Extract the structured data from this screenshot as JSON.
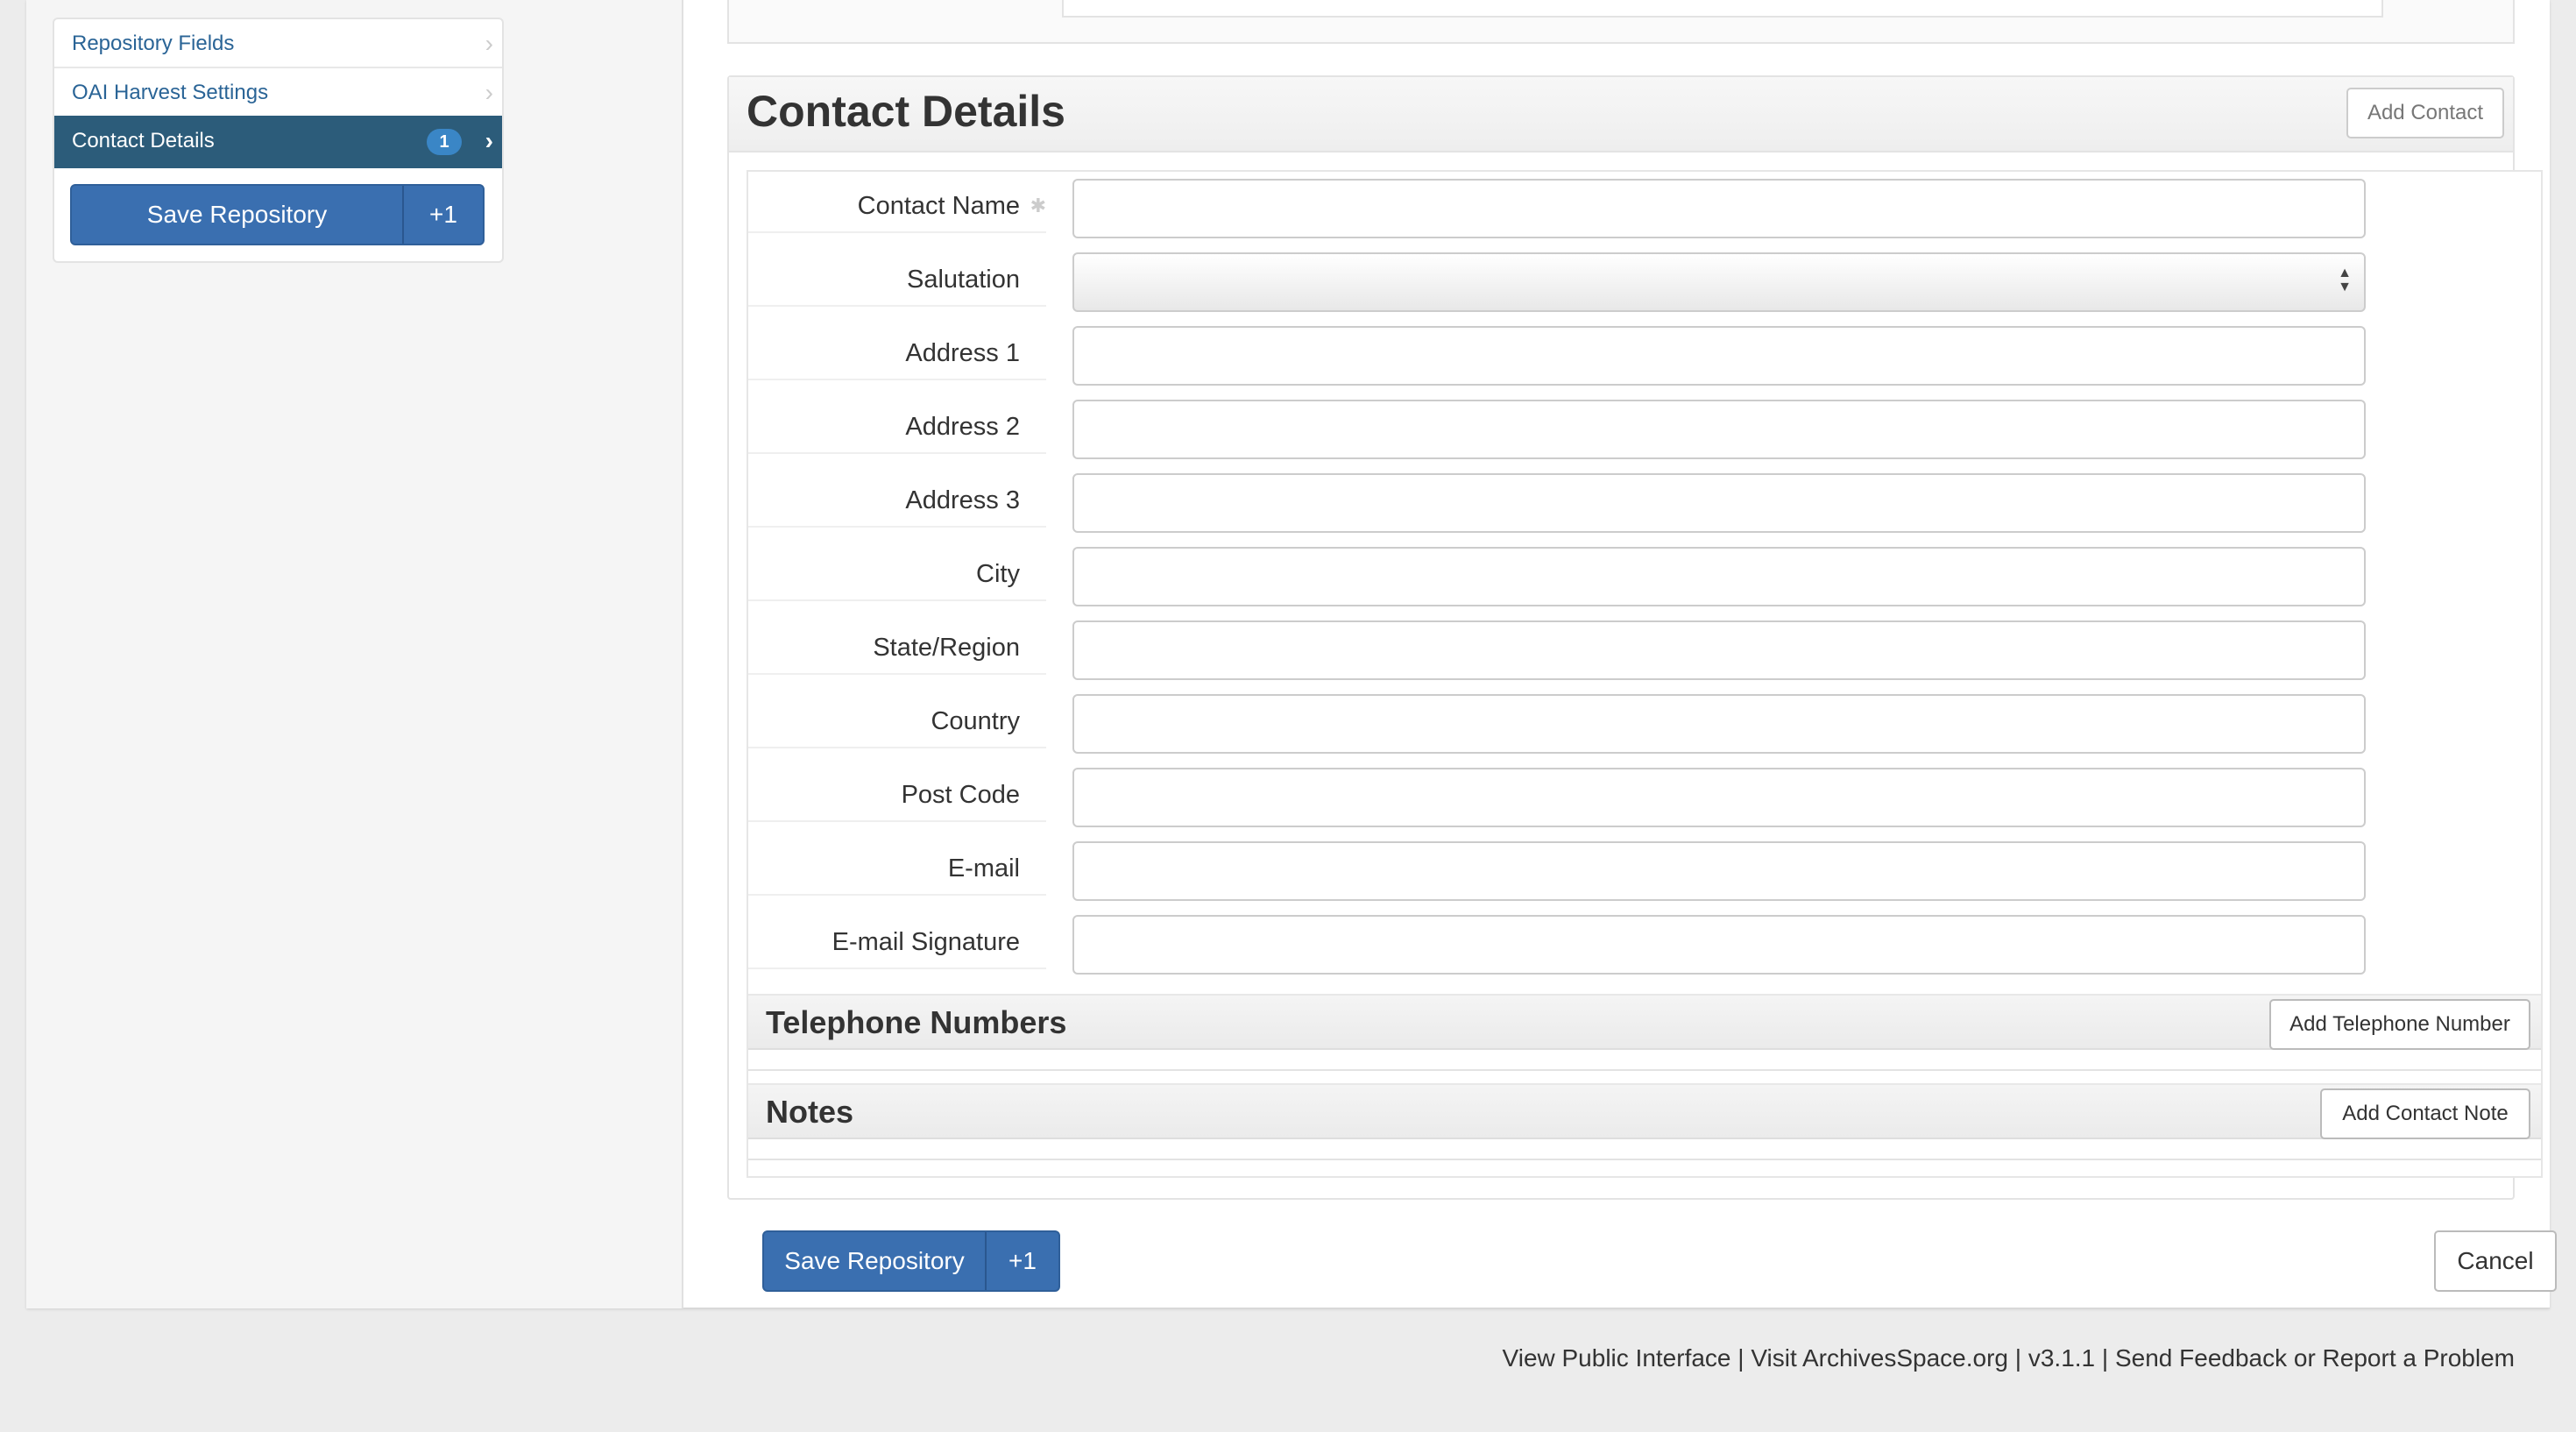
{
  "sidebar": {
    "items": [
      {
        "label": "Repository Fields"
      },
      {
        "label": "OAI Harvest Settings"
      },
      {
        "label": "Contact Details",
        "badge": "1"
      }
    ],
    "save_label": "Save Repository",
    "save_extra": "+1"
  },
  "contact": {
    "title": "Contact Details",
    "add_button": "Add Contact",
    "fields": [
      {
        "label": "Contact Name",
        "value": ""
      },
      {
        "label": "Salutation",
        "value": ""
      },
      {
        "label": "Address 1",
        "value": ""
      },
      {
        "label": "Address 2",
        "value": ""
      },
      {
        "label": "Address 3",
        "value": ""
      },
      {
        "label": "City",
        "value": ""
      },
      {
        "label": "State/Region",
        "value": ""
      },
      {
        "label": "Country",
        "value": ""
      },
      {
        "label": "Post Code",
        "value": ""
      },
      {
        "label": "E-mail",
        "value": ""
      },
      {
        "label": "E-mail Signature",
        "value": ""
      }
    ],
    "telephone": {
      "title": "Telephone Numbers",
      "add_button": "Add Telephone Number"
    },
    "notes": {
      "title": "Notes",
      "add_button": "Add Contact Note"
    }
  },
  "form_actions": {
    "save_label": "Save Repository",
    "save_extra": "+1",
    "cancel_label": "Cancel"
  },
  "footer": {
    "public_interface": "View Public Interface",
    "visit": "Visit ArchivesSpace.org",
    "version": "v3.1.1",
    "feedback": "Send Feedback or Report a Problem",
    "separator": " | "
  },
  "colors": {
    "active_nav": "#2c5c7a",
    "primary_button": "#3a6fb0",
    "link": "#2a6496"
  }
}
